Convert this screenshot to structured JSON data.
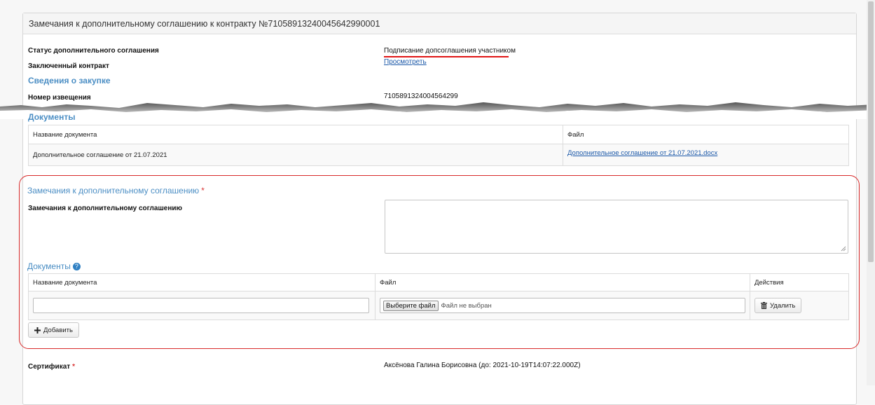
{
  "panel": {
    "title": "Замечания к дополнительному соглашению к контракту №7105891324004564299​0001"
  },
  "info": {
    "status_label": "Статус дополнительного соглашения",
    "status_value": "Подписание допсоглашения участником",
    "contract_label": "Заключенный контракт",
    "contract_link": "Просмотреть",
    "purchase_section": "Сведения о закупке",
    "notice_label": "Номер извещения",
    "notice_value": "7105891324004564299"
  },
  "documents": {
    "section": "Документы",
    "col_name": "Название документа",
    "col_file": "Файл",
    "rows": [
      {
        "name": "Дополнительное соглашение от 21.07.2021",
        "file": "Дополнительное соглашение от 21.07.2021.docx"
      }
    ]
  },
  "remarks": {
    "section": "Замечания к дополнительному соглашению",
    "required_mark": "*",
    "field_label": "Замечания к дополнительному соглашению",
    "field_value": "",
    "docs_section": "Документы",
    "help_icon": "?",
    "col_name": "Название документа",
    "col_file": "Файл",
    "col_actions": "Действия",
    "name_input_value": "",
    "file_button": "Выберите файл",
    "file_status": "Файл не выбран",
    "delete_button": "Удалить",
    "add_button": "Добавить"
  },
  "certificate": {
    "label": "Сертификат",
    "required_mark": "*",
    "value": "Аксёнова Галина Борисовна (до: 2021-10-19T14:07:22.000Z)"
  },
  "colors": {
    "section_blue": "#4b8ec4",
    "link_blue": "#1b58a8",
    "highlight_red": "#d92b2b"
  }
}
